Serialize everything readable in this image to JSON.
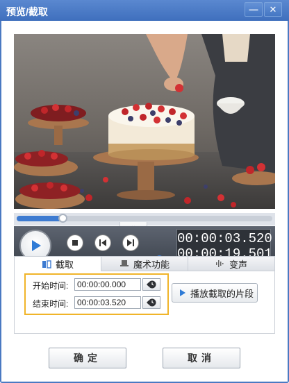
{
  "window": {
    "title": "预览/截取",
    "minimize_glyph": "—",
    "close_glyph": "✕"
  },
  "player": {
    "progress_fraction": 0.18,
    "volume_fraction": 1.0,
    "current_time": "00:00:03.520",
    "total_time": "00:00:19.501",
    "collapse_glyph": "⌄"
  },
  "tabs": [
    {
      "label": "截取",
      "icon": "scissors-icon",
      "active": true
    },
    {
      "label": "魔术功能",
      "icon": "magic-hat-icon",
      "active": false
    },
    {
      "label": "变声",
      "icon": "sound-wave-icon",
      "active": false
    }
  ],
  "trim": {
    "start_label": "开始时间:",
    "start_value": "00:00:00.000",
    "end_label": "结束时间:",
    "end_value": "00:00:03.520",
    "play_segment_label": "播放截取的片段"
  },
  "footer": {
    "ok_label": "确定",
    "cancel_label": "取消"
  },
  "colors": {
    "title_bar": "#4a79c2",
    "accent_blue": "#3d7bd1",
    "highlight_border": "#f0b429"
  }
}
